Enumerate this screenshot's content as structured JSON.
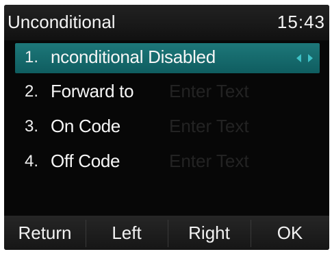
{
  "header": {
    "title": "Unconditional",
    "time": "15:43"
  },
  "menu": {
    "items": [
      {
        "number": "1.",
        "label": "nconditional Disabled",
        "value": "",
        "selected": true
      },
      {
        "number": "2.",
        "label": "Forward to",
        "value": "Enter Text",
        "selected": false
      },
      {
        "number": "3.",
        "label": "On Code",
        "value": "Enter Text",
        "selected": false
      },
      {
        "number": "4.",
        "label": "Off Code",
        "value": "Enter Text",
        "selected": false
      }
    ]
  },
  "softkeys": {
    "return": "Return",
    "left": "Left",
    "right": "Right",
    "ok": "OK"
  },
  "colors": {
    "screen_bg": "#070707",
    "highlight": "#1a7072",
    "arrow": "#3fc2c7",
    "text": "#f4f4f4"
  },
  "icons": {
    "selector": "left-right-arrows-icon"
  }
}
